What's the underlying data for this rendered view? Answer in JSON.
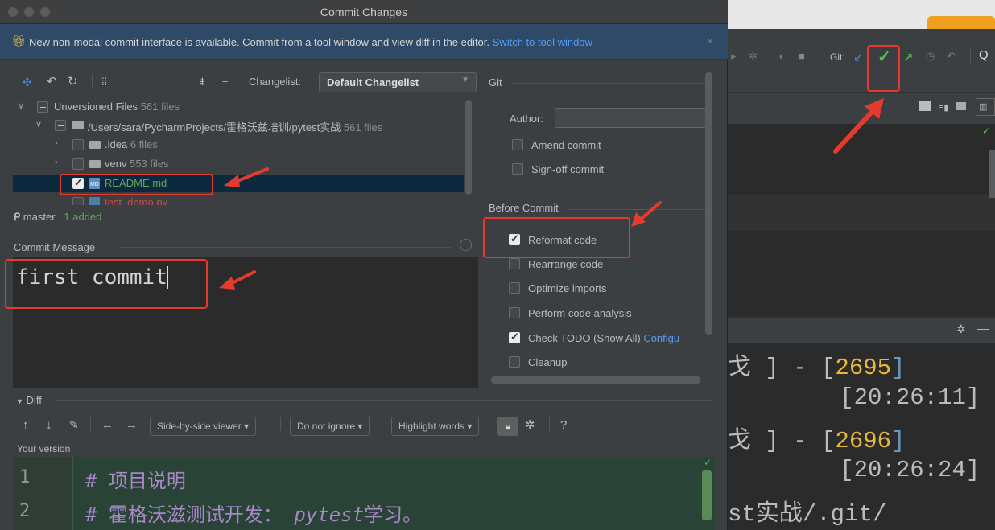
{
  "dialog": {
    "title": "Commit Changes",
    "banner_text": "New non-modal commit interface is available. Commit from a tool window and view diff in the editor.",
    "banner_link": "Switch to tool window",
    "banner_close": "×"
  },
  "changelist": {
    "label": "Changelist:",
    "value": "Default Changelist"
  },
  "tree": {
    "unversioned": {
      "label": "Unversioned Files",
      "count": "561 files"
    },
    "root": {
      "label": "/Users/sara/PycharmProjects/霍格沃兹培训/pytest实战",
      "count": "561 files"
    },
    "idea": {
      "label": ".idea",
      "count": "6 files"
    },
    "venv": {
      "label": "venv",
      "count": "553 files"
    },
    "readme": {
      "label": "README.md"
    },
    "testdemo": {
      "label": "test_demo.py"
    }
  },
  "branch": {
    "name": "master",
    "status": "1 added"
  },
  "commit_message": {
    "label": "Commit Message",
    "value": "first commit"
  },
  "git_panel": {
    "title": "Git",
    "author_label": "Author:",
    "amend": "Amend commit",
    "signoff": "Sign-off commit",
    "before_commit": "Before Commit",
    "reformat": "Reformat code",
    "rearrange": "Rearrange code",
    "optimize": "Optimize imports",
    "analysis": "Perform code analysis",
    "todo": "Check TODO (Show All)",
    "todo_link": "Configu",
    "cleanup": "Cleanup"
  },
  "diff": {
    "header": "Diff",
    "viewer": "Side-by-side viewer",
    "ignore": "Do not ignore",
    "highlight": "Highlight words",
    "help": "?",
    "your_version": "Your version",
    "lines": [
      {
        "num": "1",
        "prefix": "# ",
        "text": "项目说明"
      },
      {
        "num": "2",
        "prefix": "# ",
        "text": "霍格沃滋测试开发： ",
        "italic": "pytest",
        "suffix": "学习。"
      }
    ]
  },
  "background": {
    "git_label": "Git:",
    "terminal": [
      {
        "pre": "戈 ] - [",
        "num": "2695",
        "post": "]"
      },
      {
        "pre": "        [20:26:11]"
      },
      {
        "pre": "戈 ] - [",
        "num": "2696",
        "post": "]"
      },
      {
        "pre": "        [20:26:24]"
      },
      {
        "pre": "st实战/.git/"
      }
    ]
  },
  "colors": {
    "accent": "#589df6",
    "annotation": "#e53a2d",
    "added": "#62a85d"
  }
}
